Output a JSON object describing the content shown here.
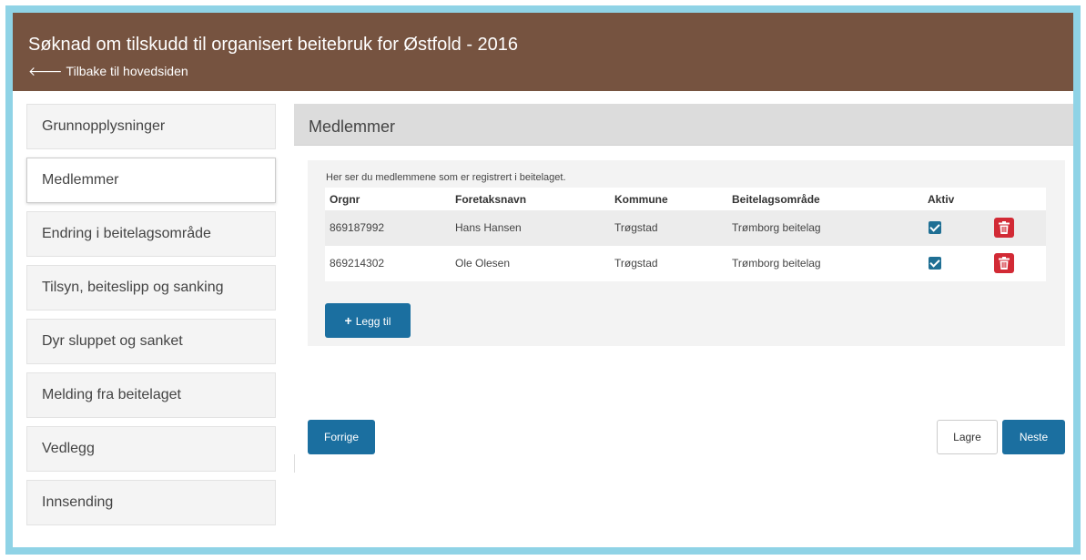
{
  "header": {
    "title": "Søknad om tilskudd til organisert beitebruk for Østfold - 2016",
    "back_label": "Tilbake til hovedsiden",
    "back_icon": "arrow-left-icon",
    "background_color": "#765340"
  },
  "sidebar": {
    "items": [
      {
        "label": "Grunnopplysninger",
        "active": false
      },
      {
        "label": "Medlemmer",
        "active": true
      },
      {
        "label": "Endring i beitelagsområde",
        "active": false
      },
      {
        "label": "Tilsyn, beiteslipp og sanking",
        "active": false
      },
      {
        "label": "Dyr sluppet og sanket",
        "active": false
      },
      {
        "label": "Melding fra beitelaget",
        "active": false
      },
      {
        "label": "Vedlegg",
        "active": false
      },
      {
        "label": "Innsending",
        "active": false
      }
    ]
  },
  "main": {
    "title": "Medlemmer",
    "intro": "Her ser du medlemmene som er registrert i beitelaget.",
    "columns": [
      "Orgnr",
      "Foretaksnavn",
      "Kommune",
      "Beitelagsområde",
      "Aktiv"
    ],
    "rows": [
      {
        "orgnr": "869187992",
        "name": "Hans Hansen",
        "kommune": "Trøgstad",
        "omrade": "Trømborg beitelag",
        "aktiv": true
      },
      {
        "orgnr": "869214302",
        "name": "Ole Olesen",
        "kommune": "Trøgstad",
        "omrade": "Trømborg beitelag",
        "aktiv": true
      }
    ],
    "add_label": "Legg til",
    "add_icon": "plus-icon",
    "delete_icon": "trash-icon"
  },
  "footer": {
    "prev_label": "Forrige",
    "save_label": "Lagre",
    "next_label": "Neste"
  },
  "colors": {
    "primary": "#1b6fa0",
    "danger": "#d22a35",
    "frame": "#8fd3e6"
  }
}
